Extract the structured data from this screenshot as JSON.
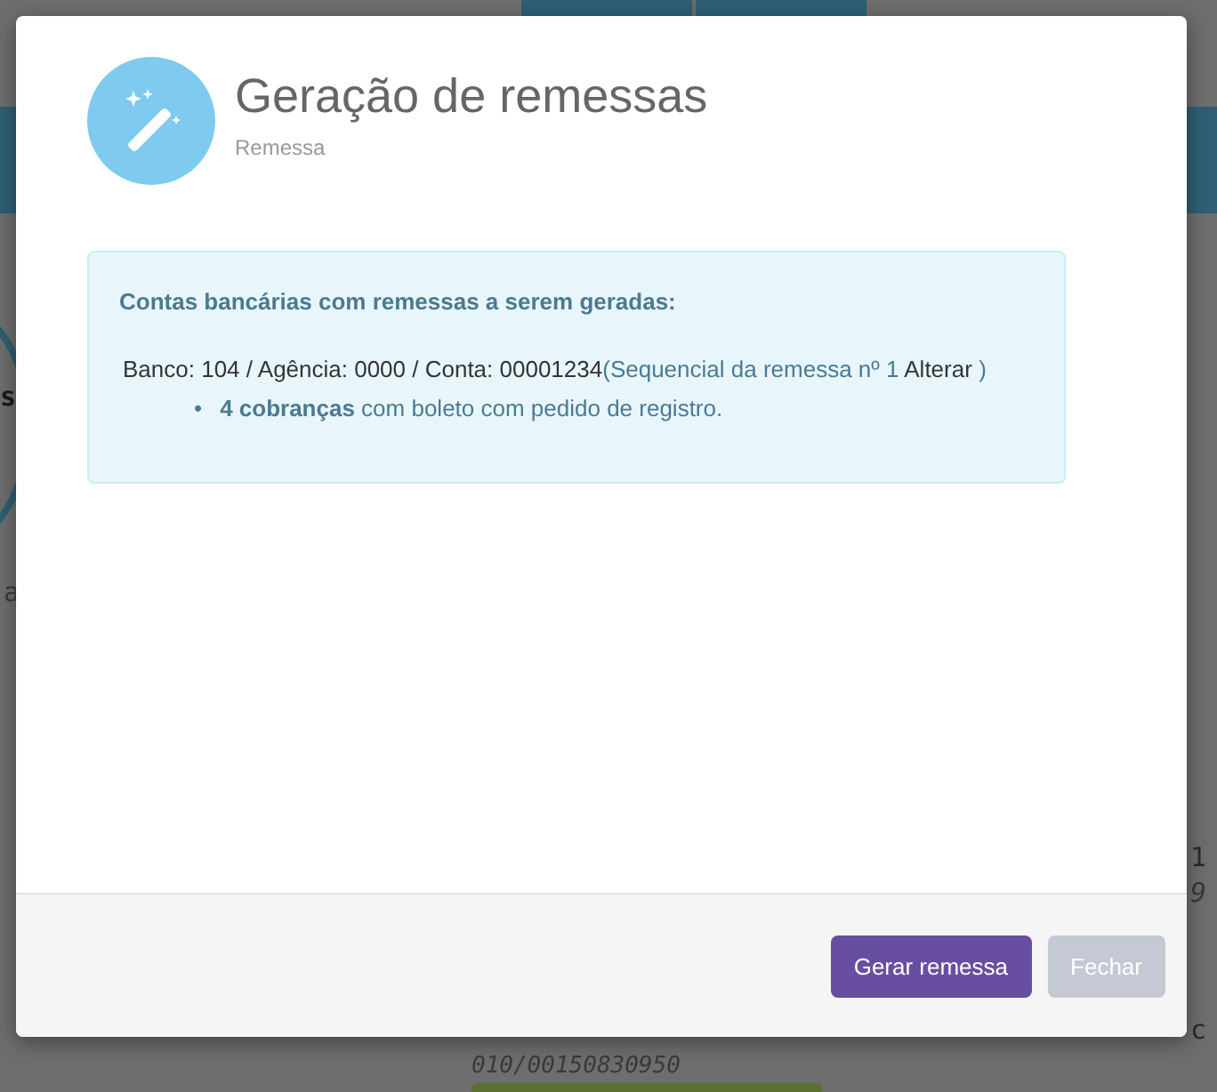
{
  "background": {
    "fragments": [
      {
        "text": "s",
        "kind": "left_bold"
      },
      {
        "text": "a",
        "kind": "left"
      },
      {
        "text": "1",
        "kind": "right"
      },
      {
        "text": "9",
        "kind": "right_italic"
      },
      {
        "text": "c",
        "kind": "right_low"
      }
    ],
    "row": {
      "code": "010/00150830950"
    }
  },
  "modal": {
    "title": "Geração de remessas",
    "subtitle": "Remessa",
    "alert": {
      "heading": "Contas bancárias com remessas a serem geradas:",
      "accounts": [
        {
          "label": "Banco: 104 / Agência: 0000 / Conta: 00001234",
          "sequence": "(Sequencial da remessa nº 1",
          "link": "Alterar",
          "close": ")",
          "items": [
            {
              "marker": "•",
              "text": "**4 cobranças** com boleto com pedido de registro."
            }
          ]
        }
      ]
    },
    "buttons": [
      {
        "label": "Gerar remessa",
        "disabled": false
      },
      {
        "label": "Fechar",
        "disabled": true
      }
    ]
  }
}
